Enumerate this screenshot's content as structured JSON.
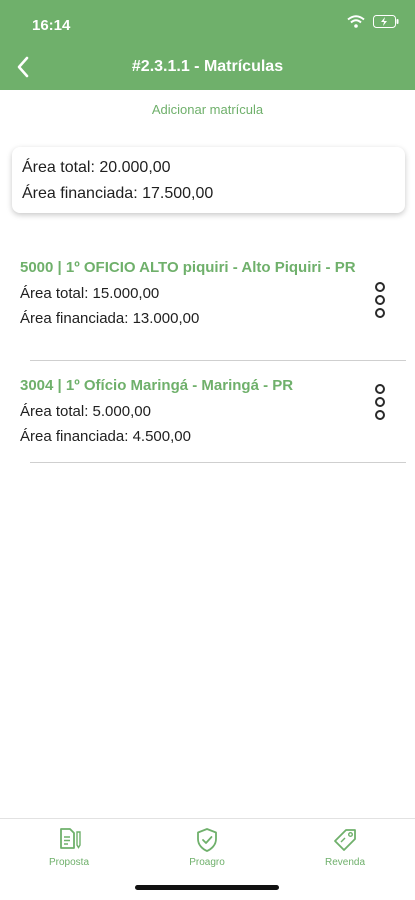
{
  "status_bar": {
    "time": "16:14"
  },
  "header": {
    "title": "#2.3.1.1 - Matrículas"
  },
  "actions": {
    "add_label": "Adicionar matrícula"
  },
  "summary": {
    "total": "Área total: 20.000,00",
    "financed": "Área financiada: 17.500,00"
  },
  "registrations": [
    {
      "title": "5000 | 1º OFICIO ALTO piquiri - Alto Piquiri - PR",
      "total": "Área total: 15.000,00",
      "financed": "Área financiada: 13.000,00"
    },
    {
      "title": "3004 | 1º Ofício Maringá - Maringá - PR",
      "total": "Área total: 5.000,00",
      "financed": "Área financiada: 4.500,00"
    }
  ],
  "tabs": [
    {
      "label": "Proposta",
      "icon": "document-icon"
    },
    {
      "label": "Proagro",
      "icon": "shield-check-icon"
    },
    {
      "label": "Revenda",
      "icon": "tag-icon"
    }
  ],
  "colors": {
    "accent": "#6fb06b"
  }
}
